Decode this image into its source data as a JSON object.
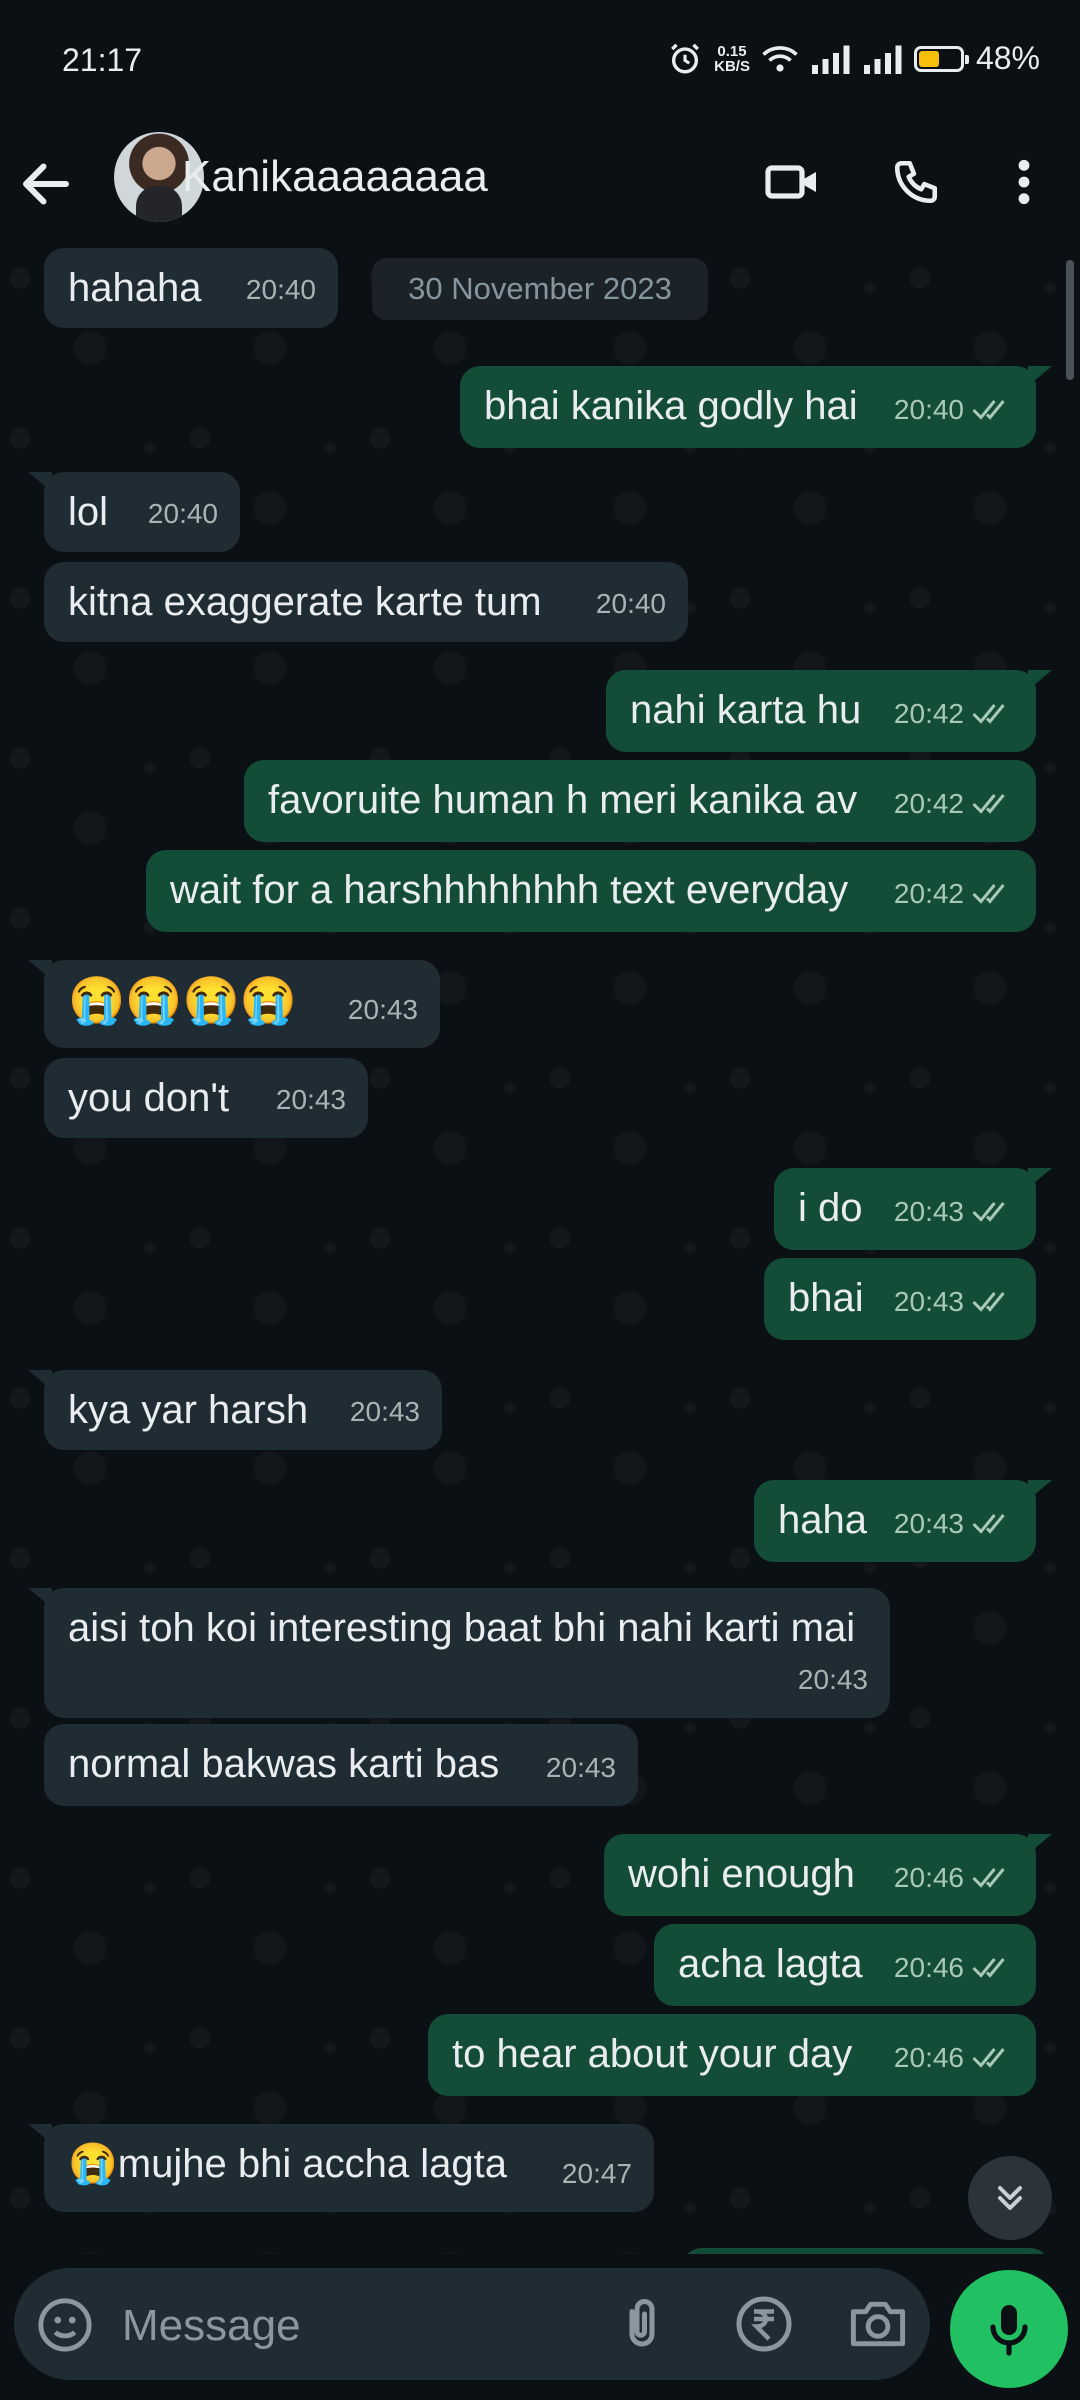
{
  "status_bar": {
    "time": "21:17",
    "network_speed_value": "0.15",
    "network_speed_unit": "KB/S",
    "battery_percent": "48%"
  },
  "header": {
    "contact_name": "Kanikaaaaaaaa",
    "icons": [
      "back-arrow-icon",
      "video-call-icon",
      "phone-icon",
      "more-icon"
    ]
  },
  "chat": {
    "date_chip": "30 November 2023",
    "messages": [
      {
        "dir": "in",
        "text": "hahaha",
        "time": "20:40"
      },
      {
        "dir": "out",
        "text": "bhai kanika godly hai",
        "time": "20:40"
      },
      {
        "dir": "in",
        "text": "lol",
        "time": "20:40"
      },
      {
        "dir": "in",
        "text": "kitna exaggerate karte tum",
        "time": "20:40"
      },
      {
        "dir": "out",
        "text": "nahi karta hu",
        "time": "20:42"
      },
      {
        "dir": "out",
        "text": "favoruite human h meri kanika av",
        "time": "20:42"
      },
      {
        "dir": "out",
        "text": "wait for a harshhhhhhhh text everyday",
        "time": "20:42"
      },
      {
        "dir": "in",
        "text": "😭😭😭😭",
        "time": "20:43"
      },
      {
        "dir": "in",
        "text": "you don't",
        "time": "20:43"
      },
      {
        "dir": "out",
        "text": "i do",
        "time": "20:43"
      },
      {
        "dir": "out",
        "text": "bhai",
        "time": "20:43"
      },
      {
        "dir": "in",
        "text": "kya yar harsh",
        "time": "20:43"
      },
      {
        "dir": "out",
        "text": "haha",
        "time": "20:43"
      },
      {
        "dir": "in",
        "text": "aisi toh koi interesting baat bhi nahi karti mai",
        "time": "20:43"
      },
      {
        "dir": "in",
        "text": "normal bakwas karti bas",
        "time": "20:43"
      },
      {
        "dir": "out",
        "text": "wohi enough",
        "time": "20:46"
      },
      {
        "dir": "out",
        "text": "acha lagta",
        "time": "20:46"
      },
      {
        "dir": "out",
        "text": "to hear about your day",
        "time": "20:46"
      },
      {
        "dir": "in",
        "text": "😭mujhe bhi accha lagta",
        "time": "20:47"
      }
    ]
  },
  "composer": {
    "placeholder": "Message"
  },
  "colors": {
    "background": "#0b1014",
    "incoming_bubble": "#1f2c33",
    "outgoing_bubble": "#144d37",
    "accent_green": "#21c063",
    "battery_yellow": "#f6c00a"
  }
}
